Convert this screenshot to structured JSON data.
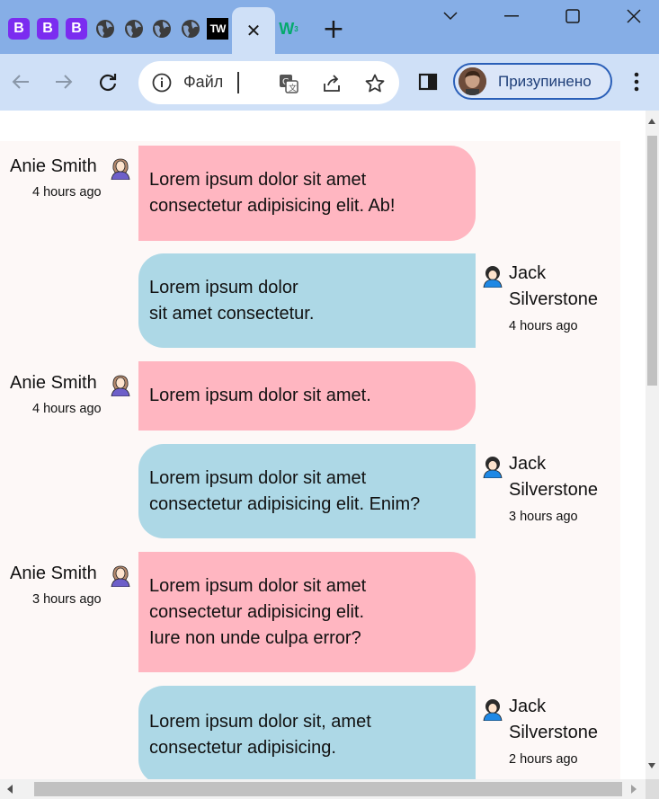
{
  "tabs": {
    "items": [
      {
        "icon": "bootstrap-icon",
        "letter": "B"
      },
      {
        "icon": "bootstrap-icon",
        "letter": "B"
      },
      {
        "icon": "bootstrap-icon",
        "letter": "B"
      },
      {
        "icon": "globe-icon"
      },
      {
        "icon": "globe-icon"
      },
      {
        "icon": "globe-icon"
      },
      {
        "icon": "globe-icon"
      },
      {
        "icon": "tw-icon",
        "letter": "TW"
      },
      {
        "icon": "close-icon",
        "active": true
      },
      {
        "icon": "w3schools-icon",
        "letter": "W3"
      }
    ],
    "active_close": "✕",
    "new_tab": "+"
  },
  "toolbar": {
    "address_label": "Файл",
    "profile_label": "Призупинено"
  },
  "messages": [
    {
      "author": "Anie Smith",
      "side": "left",
      "time": "4 hours ago",
      "text": "Lorem ipsum dolor sit amet\nconsectetur adipisicing elit. Ab!"
    },
    {
      "author": "Jack\nSilverstone",
      "side": "right",
      "time": "4 hours ago",
      "text": "Lorem ipsum dolor\nsit amet consectetur."
    },
    {
      "author": "Anie Smith",
      "side": "left",
      "time": "4 hours ago",
      "text": "Lorem ipsum dolor sit amet."
    },
    {
      "author": "Jack\nSilverstone",
      "side": "right",
      "time": "3 hours ago",
      "text": "Lorem ipsum dolor sit amet\nconsectetur adipisicing elit. Enim?"
    },
    {
      "author": "Anie Smith",
      "side": "left",
      "time": "3 hours ago",
      "text": "Lorem ipsum dolor sit amet\nconsectetur adipisicing elit.\nIure non unde culpa error?"
    },
    {
      "author": "Jack\nSilverstone",
      "side": "right",
      "time": "2 hours ago",
      "text": "Lorem ipsum dolor sit, amet\nconsectetur adipisicing."
    }
  ],
  "colors": {
    "left_bubble": "#ffb6c1",
    "right_bubble": "#add8e6",
    "chat_background": "#fdf8f7",
    "tabstrip": "#86aee6",
    "toolbar": "#cfe0f7"
  }
}
